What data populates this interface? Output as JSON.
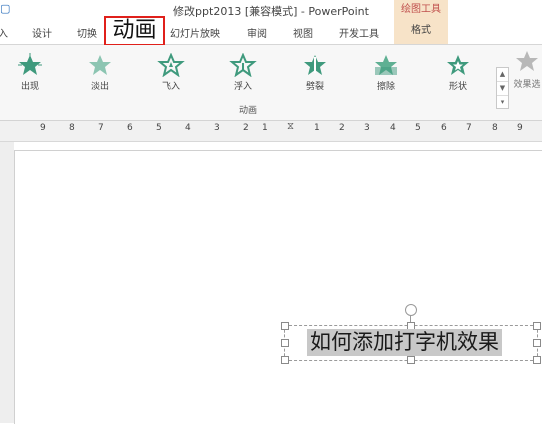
{
  "window": {
    "title": "修改ppt2013 [兼容模式] - PowerPoint",
    "context_group": "绘图工具"
  },
  "tabs": [
    {
      "label": "入"
    },
    {
      "label": "设计"
    },
    {
      "label": "切换"
    },
    {
      "label": "幻灯片放映"
    },
    {
      "label": "审阅"
    },
    {
      "label": "视图"
    },
    {
      "label": "开发工具"
    },
    {
      "label": "格式"
    }
  ],
  "callout": {
    "label": "动画"
  },
  "ribbon": {
    "effects": [
      {
        "label": "出现",
        "icon": "star-burst-icon"
      },
      {
        "label": "淡出",
        "icon": "star-fade-icon"
      },
      {
        "label": "飞入",
        "icon": "star-fly-icon"
      },
      {
        "label": "浮入",
        "icon": "star-float-icon"
      },
      {
        "label": "劈裂",
        "icon": "star-split-icon"
      },
      {
        "label": "擦除",
        "icon": "star-wipe-icon"
      },
      {
        "label": "形状",
        "icon": "star-shape-icon"
      }
    ],
    "effect_options_label": "效果选",
    "group_label": "动画"
  },
  "ruler": {
    "ticks": [
      "9",
      "8",
      "7",
      "6",
      "5",
      "4",
      "3",
      "2",
      "1",
      "1",
      "2",
      "3",
      "4",
      "5",
      "6",
      "7",
      "8",
      "9"
    ]
  },
  "slide": {
    "textbox_text": "如何添加打字机效果"
  },
  "colors": {
    "accent_star": "#3f9a7d",
    "context_tab": "#f7e3c8",
    "callout_border": "#e0201b"
  }
}
